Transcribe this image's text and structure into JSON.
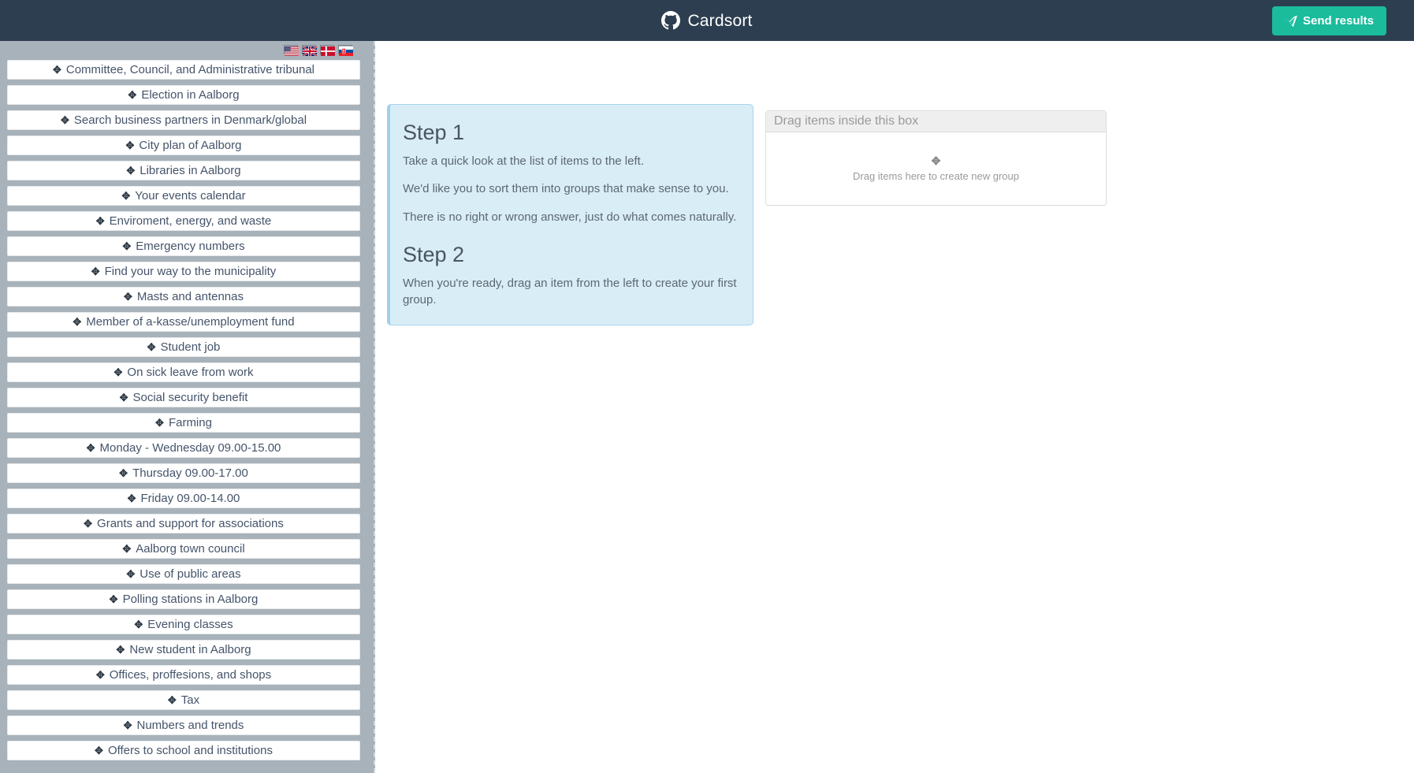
{
  "navbar": {
    "brand_label": "Cardsort",
    "brand_icon": "github-icon",
    "send_button_label": "Send results",
    "send_button_icon": "paper-plane-icon",
    "background_color": "#2d3e50",
    "send_button_color": "#1abc9c"
  },
  "sidebar": {
    "background_color": "#a7b2ba",
    "languages": [
      {
        "name": "english-us",
        "title": "English (US)"
      },
      {
        "name": "english-uk",
        "title": "English (UK)"
      },
      {
        "name": "danish",
        "title": "Dansk"
      },
      {
        "name": "slovak",
        "title": "Slovensky"
      }
    ],
    "item_icon": "move-arrows-icon",
    "items": [
      "Committee, Council, and Administrative tribunal",
      "Election in Aalborg",
      "Search business partners in Denmark/global",
      "City plan of Aalborg",
      "Libraries in Aalborg",
      "Your events calendar",
      "Enviroment, energy, and waste",
      "Emergency numbers",
      "Find your way to the municipality",
      "Masts and antennas",
      "Member of a-kasse/unemployment fund",
      "Student job",
      "On sick leave from work",
      "Social security benefit",
      "Farming",
      "Monday - Wednesday 09.00-15.00",
      "Thursday 09.00-17.00",
      "Friday 09.00-14.00",
      "Grants and support for associations",
      "Aalborg town council",
      "Use of public areas",
      "Polling stations in Aalborg",
      "Evening classes",
      "New student in Aalborg",
      "Offices, proffesions, and shops",
      "Tax",
      "Numbers and trends",
      "Offers to school and institutions"
    ]
  },
  "instructions": {
    "step1_title": "Step 1",
    "step1_para1": "Take a quick look at the list of items to the left.",
    "step1_para2": "We'd like you to sort them into groups that make sense to you.",
    "step1_para3": "There is no right or wrong answer, just do what comes naturally.",
    "step2_title": "Step 2",
    "step2_para1": "When you're ready, drag an item from the left to create your first group.",
    "background_color": "#d9edf7",
    "border_color": "#a8d5ee"
  },
  "dropzone": {
    "header_label": "Drag items inside this box",
    "hint_label": "Drag items here to create new group",
    "hint_icon": "move-arrows-icon"
  }
}
